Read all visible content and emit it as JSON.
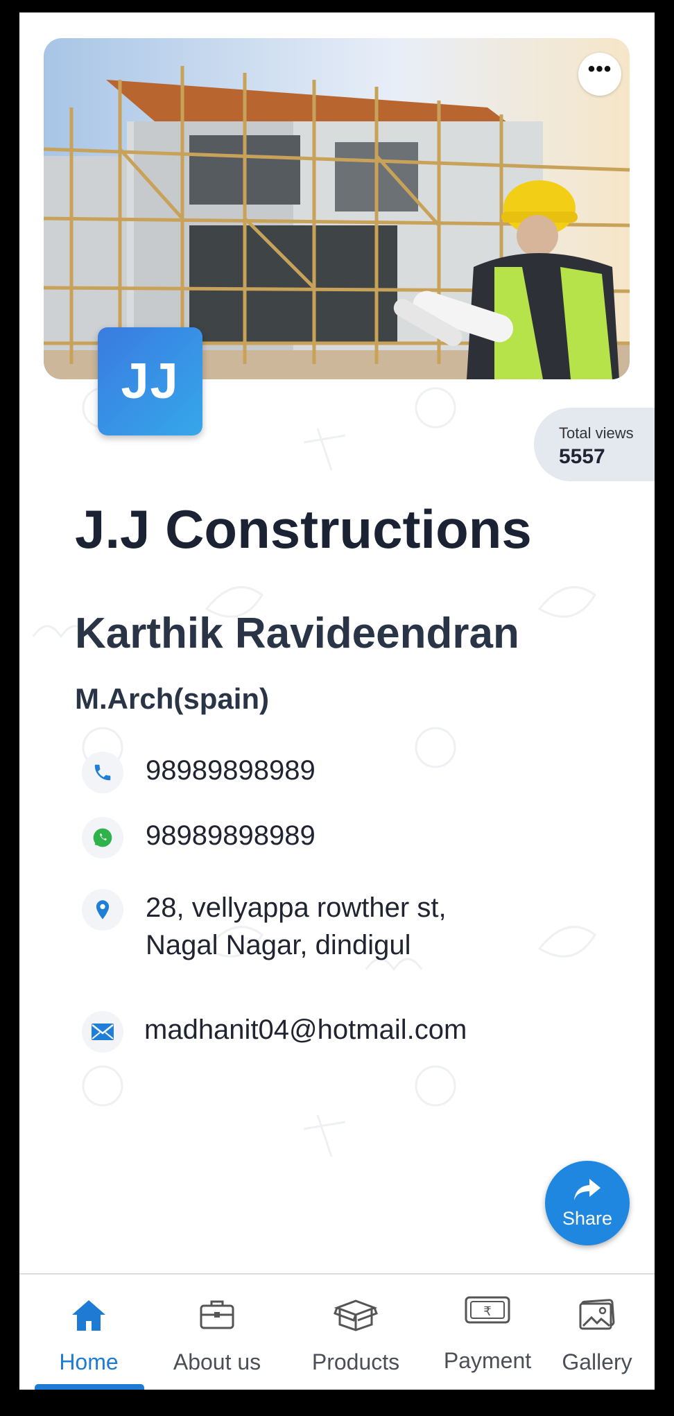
{
  "cover": {
    "more_icon": "ellipsis-icon",
    "more_label": "•••"
  },
  "logo": {
    "initials": "JJ",
    "gradient": [
      "#3a7be0",
      "#36a7ea"
    ]
  },
  "stats": {
    "views_label": "Total views",
    "views_value": "5557"
  },
  "profile": {
    "company": "J.J Constructions",
    "name": "Karthik Ravideendran",
    "qualification": "M.Arch(spain)"
  },
  "contacts": [
    {
      "icon": "phone-icon",
      "text": "98989898989"
    },
    {
      "icon": "whatsapp-icon",
      "text": "98989898989"
    },
    {
      "icon": "location-pin-icon",
      "line1": "28, vellyappa rowther st,",
      "line2": "Nagal Nagar, dindigul"
    },
    {
      "icon": "mail-icon",
      "text": "madhanit04@hotmail.com"
    }
  ],
  "share": {
    "label": "Share",
    "icon": "share-arrow-icon"
  },
  "nav": {
    "items": [
      {
        "label": "Home",
        "icon": "home-icon"
      },
      {
        "label": "About us",
        "icon": "briefcase-icon"
      },
      {
        "label": "Products",
        "icon": "box-icon"
      },
      {
        "label": "Payment",
        "icon": "rupee-note-icon"
      },
      {
        "label": "Gallery",
        "icon": "image-icon"
      }
    ],
    "active_index": 0
  },
  "colors": {
    "accent": "#1d7bd6",
    "heading": "#1b2233",
    "status_bg": "#e4e8ef"
  }
}
